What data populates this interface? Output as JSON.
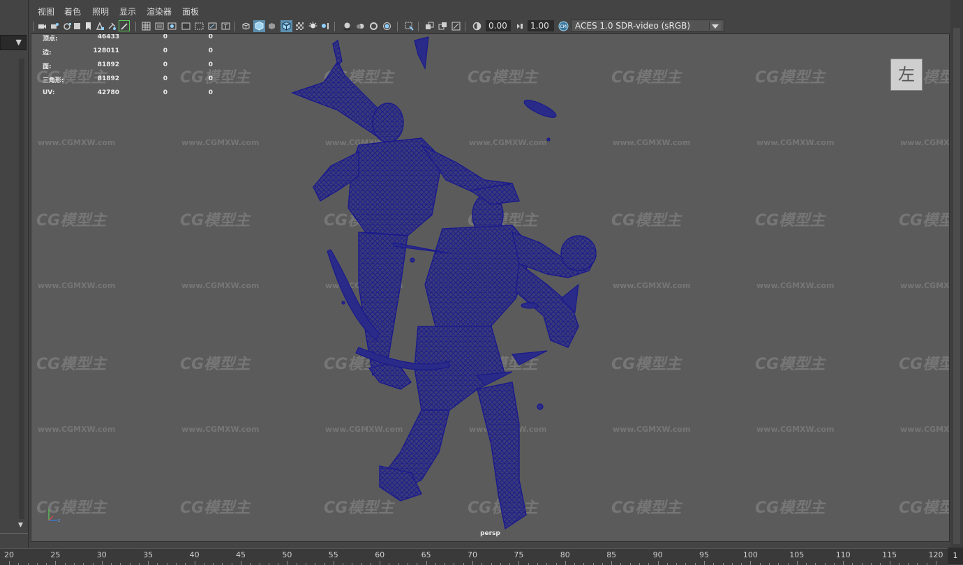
{
  "menu": [
    "视图",
    "着色",
    "照明",
    "显示",
    "渲染器",
    "面板"
  ],
  "toolbar": {
    "exposure_value": "0.00",
    "gamma_value": "1.00",
    "color_space": "ACES 1.0 SDR-video (sRGB)"
  },
  "hud": {
    "rows": [
      {
        "label": "顶点:",
        "value": "46433",
        "sel": "0",
        "uv": "0"
      },
      {
        "label": "边:",
        "value": "128011",
        "sel": "0",
        "uv": "0"
      },
      {
        "label": "面:",
        "value": "81892",
        "sel": "0",
        "uv": "0"
      },
      {
        "label": "三角形:",
        "value": "81892",
        "sel": "0",
        "uv": "0"
      },
      {
        "label": "UV:",
        "value": "42780",
        "sel": "0",
        "uv": "0"
      }
    ]
  },
  "viewport": {
    "camera_label": "persp",
    "view_cube_label": "左",
    "mesh_color": "#1a1a8c"
  },
  "watermark": {
    "logo_text": "CG模型主",
    "url_text": "www.CGMXW.com"
  },
  "timeline": {
    "ticks": [
      "20",
      "25",
      "30",
      "35",
      "40",
      "45",
      "50",
      "55",
      "60",
      "65",
      "70",
      "75",
      "80",
      "85",
      "90",
      "95",
      "100",
      "105",
      "110",
      "115",
      "120"
    ],
    "current_frame": "1"
  }
}
